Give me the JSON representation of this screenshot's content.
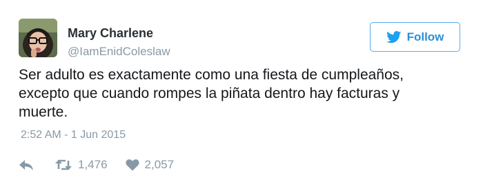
{
  "user": {
    "name": "Mary Charlene",
    "handle": "@IamEnidColeslaw"
  },
  "follow_button": {
    "label": "Follow",
    "icon": "twitter-bird-icon"
  },
  "tweet": {
    "lines": [
      "Ser adulto es exactamente como una fiesta de cumpleaños,",
      "excepto que cuando rompes la piñata dentro hay facturas y",
      "muerte."
    ],
    "timestamp": "2:52 AM - 1 Jun 2015"
  },
  "actions": {
    "reply_icon": "reply-icon",
    "retweet_icon": "retweet-icon",
    "retweet_count": "1,476",
    "like_icon": "heart-icon",
    "like_count": "2,057"
  },
  "colors": {
    "accent": "#1da1f2",
    "muted": "#8899a6",
    "text": "#14171a"
  }
}
